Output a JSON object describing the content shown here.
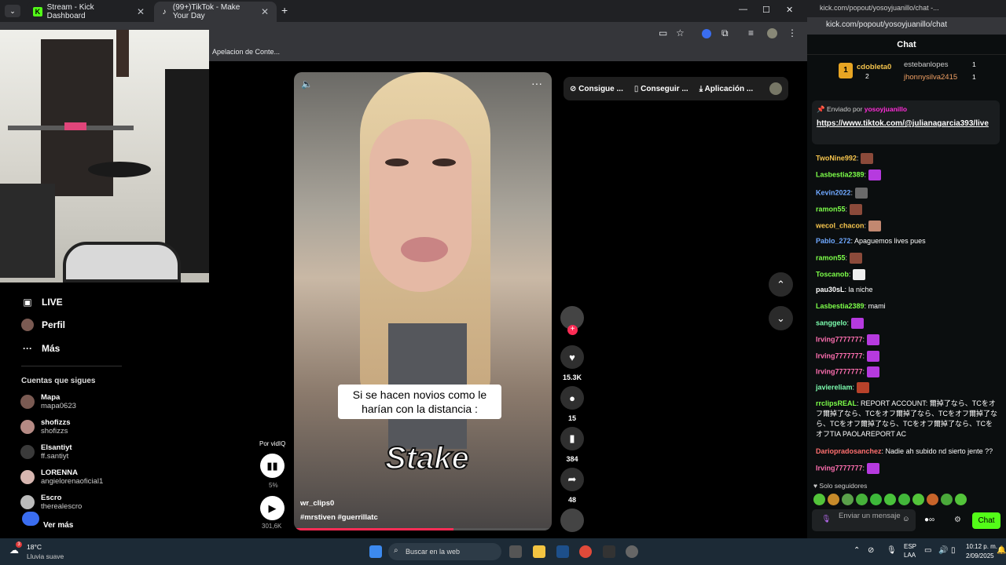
{
  "browser": {
    "tabs": [
      {
        "title": "Stream - Kick Dashboard"
      },
      {
        "title": "(99+)TikTok - Make Your Day"
      }
    ],
    "bookmark": "Apelacion de Conte..."
  },
  "tiktok": {
    "nav": [
      {
        "label": "LIVE",
        "icon": "live-icon"
      },
      {
        "label": "Perfil",
        "icon": "avatar-icon"
      },
      {
        "label": "Más",
        "icon": "more-icon"
      }
    ],
    "following_title": "Cuentas que sigues",
    "following": [
      {
        "name": "Mapa",
        "user": "mapa0623"
      },
      {
        "name": "shofizzs",
        "user": "shofizzs"
      },
      {
        "name": "Elsantiyt",
        "user": "ff.santiyt"
      },
      {
        "name": "LORENNA",
        "user": "angielorenaoficial1"
      },
      {
        "name": "Escro",
        "user": "therealescro"
      }
    ],
    "see_more": "Ver más",
    "top_buttons": [
      "Consigue ...",
      "Conseguir ...",
      "Aplicación ..."
    ],
    "video": {
      "caption": "Si se hacen novios como le harían con la distancia :",
      "brand": "Stake",
      "author": "wr_clips0",
      "tags": "#mrstiven  #guerrillatc",
      "progress": 0.62
    },
    "actions": {
      "likes": "15.3K",
      "comments": "15",
      "saves": "384",
      "shares": "48"
    },
    "por": "Por vidIQ",
    "stat_percent": "5%",
    "stat_views": "301,6K"
  },
  "chat": {
    "window_title": "kick.com/popout/yosoyjuanillo/chat -...",
    "url": "kick.com/popout/yosoyjuanillo/chat",
    "header": "Chat",
    "leaders": [
      {
        "name": "cdobleta0",
        "count": "2",
        "rank": "1"
      },
      {
        "name": "estebanlopes",
        "count": "1"
      },
      {
        "name": "jhonnysilva2415",
        "count": "1"
      }
    ],
    "pinned_by_label": "Enviado por",
    "pinned_by_user": "yosoyjuanillo",
    "pinned_link": "https://www.tiktok.com/@julianagarcia393/live",
    "messages": [
      {
        "user": "TwoNine992",
        "text": "",
        "color": "#f5c44d"
      },
      {
        "user": "Lasbestia2389",
        "text": "",
        "color": "#7dff4a"
      },
      {
        "user": "Kevin2022",
        "text": "",
        "color": "#6fa8ff"
      },
      {
        "user": "ramon55",
        "text": "",
        "color": "#7dff4a"
      },
      {
        "user": "wecol_chacon",
        "text": "",
        "color": "#f5c44d"
      },
      {
        "user": "Pablo_272",
        "text": "Apaguemos lives pues",
        "color": "#6fa8ff"
      },
      {
        "user": "ramon55",
        "text": "",
        "color": "#7dff4a"
      },
      {
        "user": "Toscanob",
        "text": "",
        "color": "#7dff4a"
      },
      {
        "user": "pau30sL",
        "text": "la niche",
        "color": "#ffffff"
      },
      {
        "user": "Lasbestia2389",
        "text": "mami",
        "color": "#7dff4a"
      },
      {
        "user": "sanggelo",
        "text": "",
        "color": "#7dffb0"
      },
      {
        "user": "Irving7777777",
        "text": "",
        "color": "#ff6fb1"
      },
      {
        "user": "Irving7777777",
        "text": "",
        "color": "#ff6fb1"
      },
      {
        "user": "Irving7777777",
        "text": "",
        "color": "#ff6fb1"
      },
      {
        "user": "javiereliam",
        "text": "",
        "color": "#7dffb0"
      },
      {
        "user": "rrclipsREAL",
        "text": "REPORT ACCOUNT: 爾掉了なら、TCをオフ爾掉了なら、TCをオフ爾掉了なら、TCをオフ爾掉了なら、TCをオフ爾掉了なら、TCをオフ爾掉了なら、TCをオフTIA PAOLAREPORT AC",
        "color": "#7dff4a"
      },
      {
        "user": "Dariopradosanchez",
        "text": "Nadie ah subido nd sierto jente ??",
        "color": "#ff6f6f"
      },
      {
        "user": "Irving7777777",
        "text": "",
        "color": "#ff6fb1"
      }
    ],
    "followers_only": "Solo seguidores",
    "input_placeholder": "Enviar un mensaje",
    "send_label": "Chat"
  },
  "taskbar": {
    "temp": "18°C",
    "weather": "Lluvia suave",
    "search_placeholder": "Buscar en la web",
    "lang": "ESP",
    "lang2": "LAA",
    "time": "10:12 p. m.",
    "date": "2/09/2025",
    "weather_badge": "3"
  },
  "colors": {
    "kick_green": "#53fc18",
    "tiktok_red": "#fe2c55"
  }
}
